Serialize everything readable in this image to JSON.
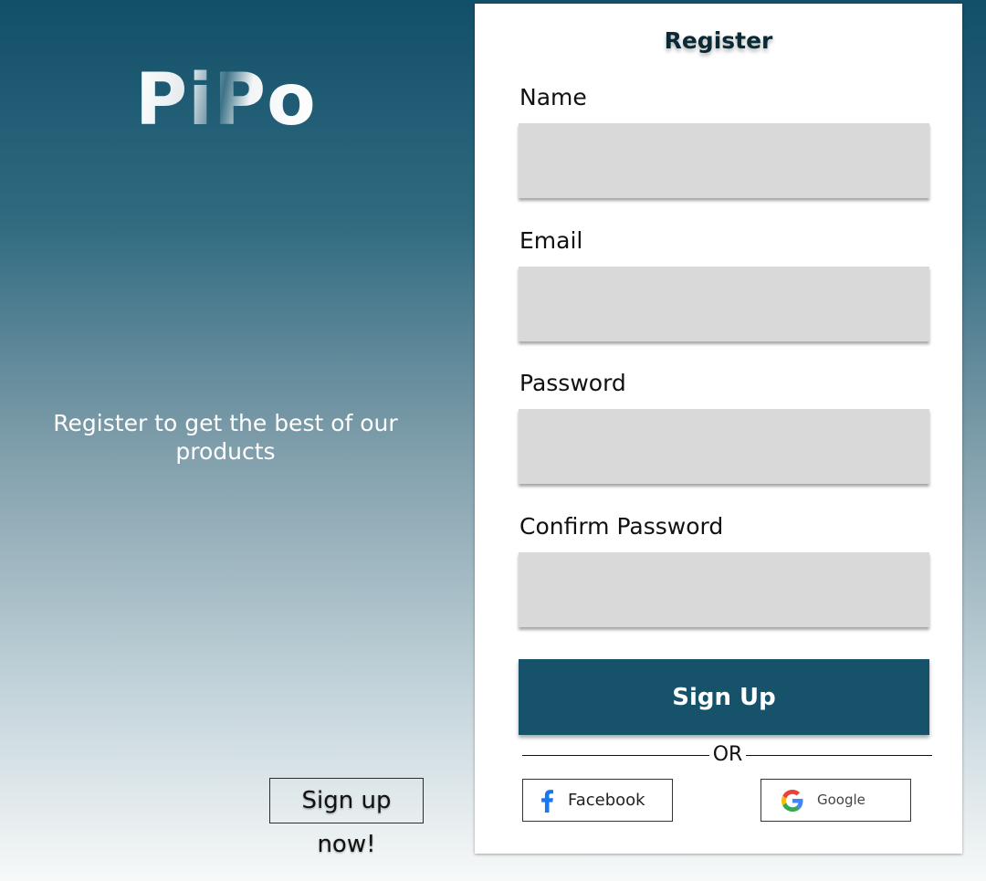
{
  "hero": {
    "logo_text": "PiPo",
    "tagline": "Register to get the best of our products",
    "signup_now_label": "Sign up now!"
  },
  "form": {
    "title": "Register",
    "fields": [
      {
        "label": "Name",
        "value": "",
        "placeholder": ""
      },
      {
        "label": "Email",
        "value": "",
        "placeholder": ""
      },
      {
        "label": "Password",
        "value": "",
        "placeholder": ""
      },
      {
        "label": "Confirm Password",
        "value": "",
        "placeholder": ""
      }
    ],
    "submit_label": "Sign Up",
    "divider_text": "OR",
    "social": {
      "facebook": {
        "label": "Facebook",
        "icon": "facebook-icon"
      },
      "google": {
        "label": "Google",
        "icon": "google-icon"
      }
    }
  },
  "colors": {
    "brand": "#16536b",
    "input_bg": "#d9d9d9",
    "gradient_top": "#124f68",
    "gradient_bottom": "#f7f9f9",
    "facebook_blue": "#1877f2",
    "google_blue": "#4285f4",
    "google_red": "#ea4335",
    "google_yellow": "#fbbc05",
    "google_green": "#34a853"
  }
}
